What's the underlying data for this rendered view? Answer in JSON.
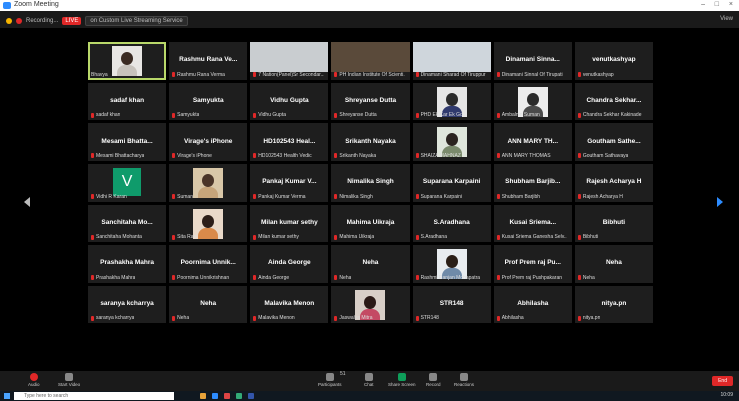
{
  "window": {
    "title": "Zoom Meeting",
    "controls": [
      "–",
      "□",
      "×"
    ]
  },
  "topbar": {
    "recording_label": "Recording...",
    "live_badge": "LIVE",
    "live_service": "on Custom Live Streaming Service",
    "view_label": "View"
  },
  "participants": [
    {
      "name": "Bhavya",
      "type": "photo",
      "active": true,
      "bg": "#e8e6e4",
      "head": "#3a2a22",
      "body": "#c7c2bc"
    },
    {
      "name": "Rashmu Rana Ve...",
      "caption": "Rashmu Rana Verma",
      "type": "text"
    },
    {
      "name": "",
      "caption": "7 Nation(Panel)Sr Secondar...",
      "type": "video",
      "bg": "#c9cdd0"
    },
    {
      "name": "",
      "caption": "PH Indian Institute Of Scienti...",
      "type": "video",
      "bg": "#5a4a3a"
    },
    {
      "name": "",
      "caption": "Dinamani Sharad Of Tiruppur",
      "type": "video",
      "bg": "#cfd6dc"
    },
    {
      "name": "Dinamani Sinna...",
      "caption": "Dinamani Sinnal Of Tirupati",
      "type": "text"
    },
    {
      "name": "venutkashyap",
      "caption": "venutkashyap",
      "type": "text"
    },
    {
      "name": "sadaf khan",
      "caption": "sadaf khan",
      "type": "text"
    },
    {
      "name": "Samyukta",
      "caption": "Samyukta",
      "type": "text"
    },
    {
      "name": "Vidhu Gupta",
      "caption": "Vidhu Gupta",
      "type": "text"
    },
    {
      "name": "Shreyanse Dutta",
      "caption": "Shreyanse Dutta",
      "type": "text"
    },
    {
      "name": "",
      "caption": "PHD Ek Kar Ek Go...",
      "type": "photo",
      "bg": "#e6e6e6",
      "head": "#2b2b2b",
      "body": "#303a6e"
    },
    {
      "name": "",
      "caption": "Ambalnin Suman",
      "type": "photo",
      "bg": "#ececec",
      "head": "#2a2a2a",
      "body": "#4a4a4a"
    },
    {
      "name": "Chandra Sekhar...",
      "caption": "Chandra Sekhar Kakinade",
      "type": "text"
    },
    {
      "name": "Mesami Bhatta...",
      "caption": "Mesami Bhattacharya",
      "type": "text"
    },
    {
      "name": "Virage's iPhone",
      "caption": "Virage's iPhone",
      "type": "text"
    },
    {
      "name": "HD102543 Heal...",
      "caption": "HD102543 Health Vedic",
      "type": "text"
    },
    {
      "name": "Srikanth Nayaka",
      "caption": "Srikanth Nayaka",
      "type": "text"
    },
    {
      "name": "",
      "caption": "SHAIZA MAHNAZ",
      "type": "photo",
      "bg": "#dfe6dc",
      "head": "#2b2420",
      "body": "#7a8a6c"
    },
    {
      "name": "ANN MARY TH...",
      "caption": "ANN MARY THOMAS",
      "type": "text"
    },
    {
      "name": "Goutham Sathe...",
      "caption": "Goutham Sathavaya",
      "type": "text"
    },
    {
      "name": "V",
      "caption": "Vidhi R Karan",
      "type": "initial"
    },
    {
      "name": "",
      "caption": "Suman",
      "type": "photo",
      "bg": "#d9c7a8",
      "head": "#4a3428",
      "body": "#c6a47a"
    },
    {
      "name": "Pankaj Kumar V...",
      "caption": "Pankaj Kumar Verma",
      "type": "text"
    },
    {
      "name": "Nimalika Singh",
      "caption": "Nimalika Singh",
      "type": "text"
    },
    {
      "name": "Suparana Karpaini",
      "caption": "Suparana Karpaini",
      "type": "text"
    },
    {
      "name": "Shubham Barjib...",
      "caption": "Shubham Barjibh",
      "type": "text"
    },
    {
      "name": "Rajesh Acharya H",
      "caption": "Rajesh Acharya H",
      "type": "text"
    },
    {
      "name": "Sanchitaha Mo...",
      "caption": "Sanchitaha Mohanta",
      "type": "text"
    },
    {
      "name": "",
      "caption": "Sita Rani",
      "type": "photo",
      "bg": "#e9d9c9",
      "head": "#2c1e18",
      "body": "#d98a4a"
    },
    {
      "name": "Milan kumar sethy",
      "caption": "Milan kumar sethy",
      "type": "text"
    },
    {
      "name": "Mahima Uikraja",
      "caption": "Mahima Uikraja",
      "type": "text"
    },
    {
      "name": "S.Aradhana",
      "caption": "S.Aradhana",
      "type": "text"
    },
    {
      "name": "Kusai Sriema...",
      "caption": "Kusai Sriema Ganesha Selv...",
      "type": "text"
    },
    {
      "name": "Bibhuti",
      "caption": "Bibhuti",
      "type": "text"
    },
    {
      "name": "Prashakha Mahra",
      "caption": "Prashakha Mahra",
      "type": "text"
    },
    {
      "name": "Poornima Unnik...",
      "caption": "Poornima Unnikrishnan",
      "type": "text"
    },
    {
      "name": "Ainda George",
      "caption": "Ainda George",
      "type": "text"
    },
    {
      "name": "Neha",
      "caption": "Neha",
      "type": "text"
    },
    {
      "name": "",
      "caption": "Rashmi Ranjan Mohapatra",
      "type": "photo",
      "bg": "#e8ecef",
      "head": "#2a1e16",
      "body": "#6f8aa8"
    },
    {
      "name": "Prof Prem raj Pu...",
      "caption": "Prof Prem raj Pushpakaran",
      "type": "text"
    },
    {
      "name": "Neha",
      "caption": "Neha",
      "type": "text"
    },
    {
      "name": "saranya kcharrya",
      "caption": "saranya kcharrya",
      "type": "text"
    },
    {
      "name": "Neha",
      "caption": "Neha",
      "type": "text"
    },
    {
      "name": "Malavika Menon",
      "caption": "Malavika Menon",
      "type": "text"
    },
    {
      "name": "",
      "caption": "Jaswalya Mitra",
      "type": "photo",
      "bg": "#d8cfc7",
      "head": "#2a1a16",
      "body": "#c44a64"
    },
    {
      "name": "STR148",
      "caption": "STR148",
      "type": "text"
    },
    {
      "name": "Abhilasha",
      "caption": "Abhilasha",
      "type": "text"
    },
    {
      "name": "nitya.pn",
      "caption": "nitya.pn",
      "type": "text"
    }
  ],
  "toolbar": {
    "items": [
      {
        "label": "Audio",
        "name": "mute"
      },
      {
        "label": "Start Video",
        "name": "video"
      },
      {
        "label": "Participants",
        "name": "participants"
      },
      {
        "label": "Chat",
        "name": "chat"
      },
      {
        "label": "Share Screen",
        "name": "share"
      },
      {
        "label": "Record",
        "name": "record"
      },
      {
        "label": "Reactions",
        "name": "reactions"
      }
    ],
    "participant_count": "51",
    "end_label": "End"
  },
  "taskbar": {
    "search_placeholder": "Type here to search",
    "time": "10:09"
  }
}
